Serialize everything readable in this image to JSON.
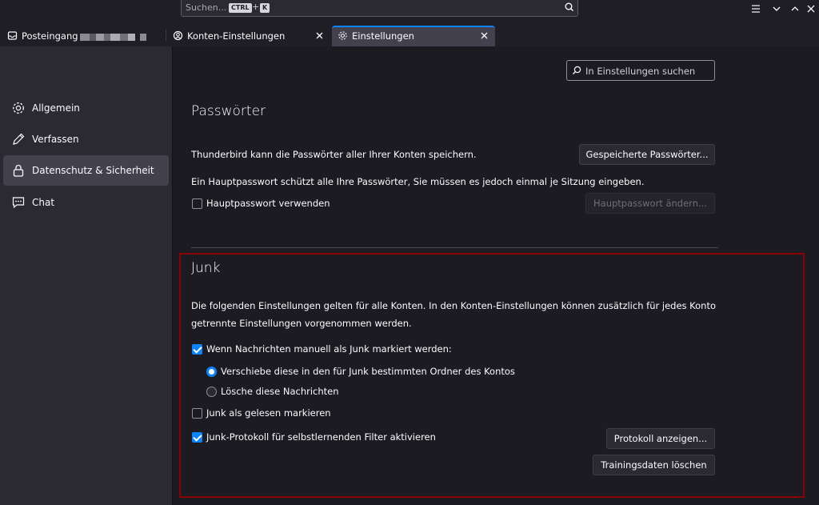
{
  "titlebar": {
    "search_placeholder": "Suchen...",
    "shortcut_ctrl": "CTRL",
    "shortcut_plus": "+",
    "shortcut_key": "K"
  },
  "tabs": [
    {
      "label": "Posteingang",
      "icon": "inbox-icon"
    },
    {
      "label": "Konten-Einstellungen",
      "icon": "account-settings-icon"
    },
    {
      "label": "Einstellungen",
      "icon": "gear-icon"
    }
  ],
  "sidebar": {
    "items": [
      {
        "label": "Allgemein",
        "icon": "gear-icon"
      },
      {
        "label": "Verfassen",
        "icon": "pencil-icon"
      },
      {
        "label": "Datenschutz & Sicherheit",
        "icon": "lock-icon"
      },
      {
        "label": "Chat",
        "icon": "chat-icon"
      }
    ]
  },
  "search": {
    "placeholder": "In Einstellungen suchen"
  },
  "passwords": {
    "title": "Passwörter",
    "save_text": "Thunderbird kann die Passwörter aller Ihrer Konten speichern.",
    "saved_button": "Gespeicherte Passwörter...",
    "master_text": "Ein Hauptpasswort schützt alle Ihre Passwörter, Sie müssen es jedoch einmal je Sitzung eingeben.",
    "use_master_label": "Hauptpasswort verwenden",
    "use_master_checked": false,
    "change_master_button": "Hauptpasswort ändern..."
  },
  "junk": {
    "title": "Junk",
    "description": "Die folgenden Einstellungen gelten für alle Konten. In den Konten-Einstellungen können zusätzlich für jedes Konto getrennte Einstellungen vorgenommen werden.",
    "manual_mark_label": "Wenn Nachrichten manuell als Junk markiert werden:",
    "manual_mark_checked": true,
    "move_option": "Verschiebe diese in den für Junk bestimmten Ordner des Kontos",
    "move_selected": true,
    "delete_option": "Lösche diese Nachrichten",
    "mark_read_label": "Junk als gelesen markieren",
    "mark_read_checked": false,
    "log_label": "Junk-Protokoll für selbstlernenden Filter aktivieren",
    "log_checked": true,
    "show_log_button": "Protokoll anzeigen...",
    "reset_training_button": "Trainingsdaten löschen"
  },
  "colors": {
    "accent": "#0a84ff",
    "highlight_border": "#8b0000"
  }
}
